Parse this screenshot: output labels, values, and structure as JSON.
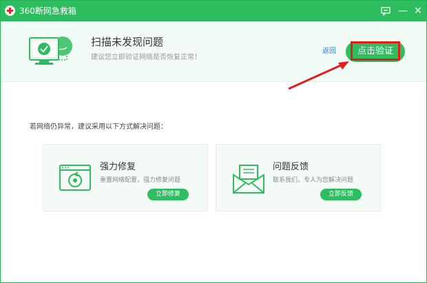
{
  "window": {
    "title": "360断网急救箱"
  },
  "titlebar": {
    "msg_icon": "message-icon",
    "min_label": "—",
    "close_label": "✕"
  },
  "header": {
    "title": "扫描未发现问题",
    "subtitle": "建议您立即验证网络是否恢复正常！",
    "back_label": "返回",
    "verify_label": "点击验证"
  },
  "body": {
    "hint": "若网络仍异常，建议采用以下方式解决问题："
  },
  "cards": [
    {
      "title": "强力修复",
      "desc": "重置网络配置，强力修复问题",
      "button": "立即修复",
      "icon": "repair-monitor-icon"
    },
    {
      "title": "问题反馈",
      "desc": "联系我们，专人为您解决问题",
      "button": "立即反馈",
      "icon": "envelope-icon"
    }
  ],
  "colors": {
    "brand_green": "#2dbd5f",
    "annotation_red": "#e01e1e",
    "link_blue": "#1f7fd8"
  }
}
